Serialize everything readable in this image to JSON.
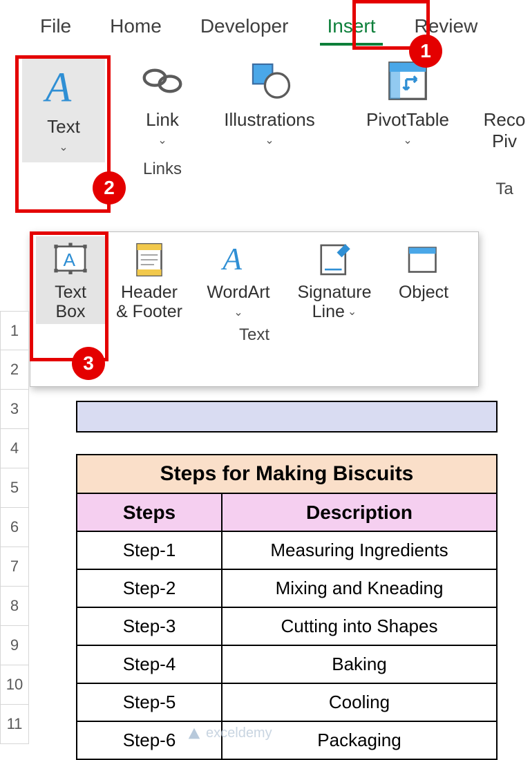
{
  "tabs": {
    "file": "File",
    "home": "Home",
    "developer": "Developer",
    "insert": "Insert",
    "review": "Review"
  },
  "ribbon": {
    "text": {
      "label": "Text"
    },
    "link": {
      "label": "Link",
      "group": "Links"
    },
    "illustrations": {
      "label": "Illustrations"
    },
    "pivottable": {
      "label": "PivotTable"
    },
    "recopiv": {
      "label1": "Reco",
      "label2": "Piv",
      "group": "Ta"
    }
  },
  "text_gallery": {
    "textbox": {
      "l1": "Text",
      "l2": "Box"
    },
    "headerfooter": {
      "l1": "Header",
      "l2": "& Footer"
    },
    "wordart": {
      "label": "WordArt"
    },
    "signature": {
      "l1": "Signature",
      "l2": "Line"
    },
    "object": {
      "label": "Object"
    },
    "group": "Text"
  },
  "callouts": {
    "c1": "1",
    "c2": "2",
    "c3": "3"
  },
  "row_headers": [
    "1",
    "2",
    "3",
    "4",
    "5",
    "6",
    "7",
    "8",
    "9",
    "10",
    "11"
  ],
  "table": {
    "title": "Steps for Making Biscuits",
    "cols": {
      "steps": "Steps",
      "desc": "Description"
    },
    "rows": [
      {
        "step": "Step-1",
        "desc": "Measuring Ingredients"
      },
      {
        "step": "Step-2",
        "desc": "Mixing and Kneading"
      },
      {
        "step": "Step-3",
        "desc": "Cutting into Shapes"
      },
      {
        "step": "Step-4",
        "desc": "Baking"
      },
      {
        "step": "Step-5",
        "desc": "Cooling"
      },
      {
        "step": "Step-6",
        "desc": "Packaging"
      }
    ]
  },
  "watermark": "exceldemy"
}
